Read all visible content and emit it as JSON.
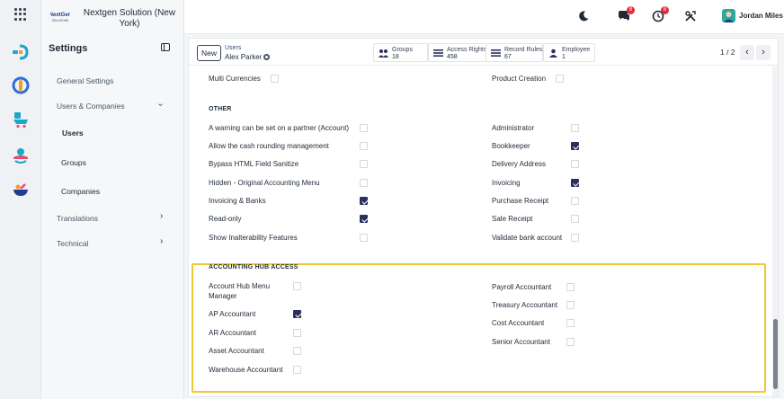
{
  "brand": {
    "company_name": "Nextgen Solution (New York)",
    "logo_text": "NextGen",
    "logo_subtext": "SOLUTIONS"
  },
  "rail": {
    "icons": [
      "apps-grid-icon",
      "discuss-icon",
      "accounting-hub-icon",
      "sales-cart-icon",
      "profile-icon",
      "hub-bowl-icon"
    ]
  },
  "sidebar": {
    "title": "Settings",
    "items": [
      {
        "label": "General Settings"
      },
      {
        "label": "Users & Companies",
        "expanded": true
      },
      {
        "label": "Users",
        "active": true
      },
      {
        "label": "Groups"
      },
      {
        "label": "Companies"
      },
      {
        "label": "Translations"
      },
      {
        "label": "Technical"
      }
    ]
  },
  "navbar": {
    "messages_badge": "8",
    "activities_badge": "8",
    "user_name": "Jordan Miles"
  },
  "control": {
    "new_label": "New",
    "breadcrumb": "Users",
    "record_name": "Alex Parker",
    "smart_buttons": [
      {
        "label": "Groups",
        "value": "18",
        "icon": "groups-icon"
      },
      {
        "label": "Access Rights",
        "value": "458",
        "icon": "list-icon"
      },
      {
        "label": "Record Rules",
        "value": "67",
        "icon": "list-icon"
      },
      {
        "label": "Employee",
        "value": "1",
        "icon": "employee-icon"
      }
    ],
    "pager": "1 / 2"
  },
  "form": {
    "top_left": {
      "label": "Multi Currencies",
      "checked": false
    },
    "top_right": {
      "label": "Product Creation",
      "checked": false
    },
    "other": {
      "heading": "OTHER",
      "left": [
        {
          "label": "A warning can be set on a partner (Account)",
          "checked": false
        },
        {
          "label": "Allow the cash rounding management",
          "checked": false
        },
        {
          "label": "Bypass HTML Field Sanitize",
          "checked": false
        },
        {
          "label": "Hidden - Original Accounting Menu",
          "checked": false
        },
        {
          "label": "Invoicing & Banks",
          "checked": true
        },
        {
          "label": "Read-only",
          "checked": true
        },
        {
          "label": "Show Inalterability Features",
          "checked": false
        }
      ],
      "right": [
        {
          "label": "Administrator",
          "checked": false
        },
        {
          "label": "Bookkeeper",
          "checked": true
        },
        {
          "label": "Delivery Address",
          "checked": false
        },
        {
          "label": "Invoicing",
          "checked": true
        },
        {
          "label": "Purchase Receipt",
          "checked": false
        },
        {
          "label": "Sale Receipt",
          "checked": false
        },
        {
          "label": "Validate bank account",
          "checked": false
        }
      ]
    },
    "hub": {
      "heading": "ACCOUNTING HUB ACCESS",
      "left": [
        {
          "label": "Account Hub Menu",
          "label2": "Manager",
          "checked": false
        },
        {
          "label": "AP Accountant",
          "checked": true
        },
        {
          "label": "AR Accountant",
          "checked": false
        },
        {
          "label": "Asset Accountant",
          "checked": false
        },
        {
          "label": "Warehouse Accountant",
          "checked": false
        }
      ],
      "right": [
        {
          "label": "Payroll Accountant",
          "checked": false
        },
        {
          "label": "Treasury Accountant",
          "checked": false
        },
        {
          "label": "Cost Accountant",
          "checked": false
        },
        {
          "label": "Senior Accountant",
          "checked": false
        }
      ]
    }
  },
  "colors": {
    "checked": "#2b2f5e",
    "highlight": "#f2c62f",
    "badge": "#e02d3c"
  }
}
